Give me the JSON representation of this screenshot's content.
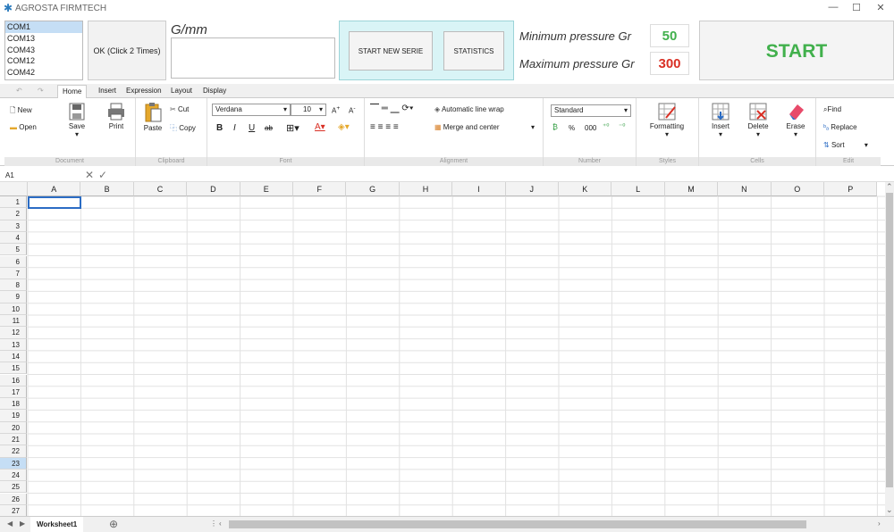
{
  "app": {
    "title": "AGROSTA FIRMTECH",
    "logo_icon": "asterisk-logo-icon"
  },
  "window": {
    "minimize": "—",
    "maximize": "☐",
    "close": "✕"
  },
  "ports": {
    "items": [
      "COM1",
      "COM13",
      "COM43",
      "COM12",
      "COM42"
    ],
    "selected": "COM1"
  },
  "ok_button": "OK (Click 2 Times)",
  "unit_label": "G/mm",
  "start_new_serie": "START NEW SERIE",
  "statistics": "STATISTICS",
  "pressure": {
    "min_label": "Minimum pressure Gr",
    "min_value": "50",
    "min_color": "#41b04c",
    "max_label": "Maximum pressure Gr",
    "max_value": "300",
    "max_color": "#d93025"
  },
  "start": "START",
  "tabs": [
    "Home",
    "Insert",
    "Expression",
    "Layout",
    "Display"
  ],
  "ribbon": {
    "document": {
      "label": "Document",
      "new": "New",
      "open": "Open",
      "save": "Save",
      "print": "Print"
    },
    "clipboard": {
      "label": "Clipboard",
      "paste": "Paste",
      "cut": "Cut",
      "copy": "Copy"
    },
    "font": {
      "label": "Font",
      "name": "Verdana",
      "size": "10",
      "bold": "B",
      "italic": "I",
      "underline": "U",
      "strike": "ab"
    },
    "alignment": {
      "label": "Alignment",
      "wrap": "Automatic line wrap",
      "merge": "Merge and center"
    },
    "number": {
      "label": "Number",
      "format": "Standard",
      "percent": "%",
      "thousands": "000"
    },
    "styles": {
      "label": "Styles",
      "formatting": "Formatting"
    },
    "cells": {
      "label": "Cells",
      "insert": "Insert",
      "delete": "Delete",
      "erase": "Erase"
    },
    "edit": {
      "label": "Edit",
      "find": "Find",
      "replace": "Replace",
      "sort": "Sort"
    }
  },
  "formula": {
    "cell_ref": "A1",
    "cancel": "✕",
    "accept": "✓"
  },
  "columns": [
    "A",
    "B",
    "C",
    "D",
    "E",
    "F",
    "G",
    "H",
    "I",
    "J",
    "K",
    "L",
    "M",
    "N",
    "O",
    "P"
  ],
  "rows": [
    "1",
    "2",
    "3",
    "4",
    "5",
    "6",
    "7",
    "8",
    "9",
    "10",
    "11",
    "12",
    "13",
    "14",
    "15",
    "16",
    "17",
    "18",
    "19",
    "20",
    "21",
    "22",
    "23",
    "24",
    "25",
    "26",
    "27"
  ],
  "sheet": {
    "name": "Worksheet1",
    "add": "⊕"
  }
}
